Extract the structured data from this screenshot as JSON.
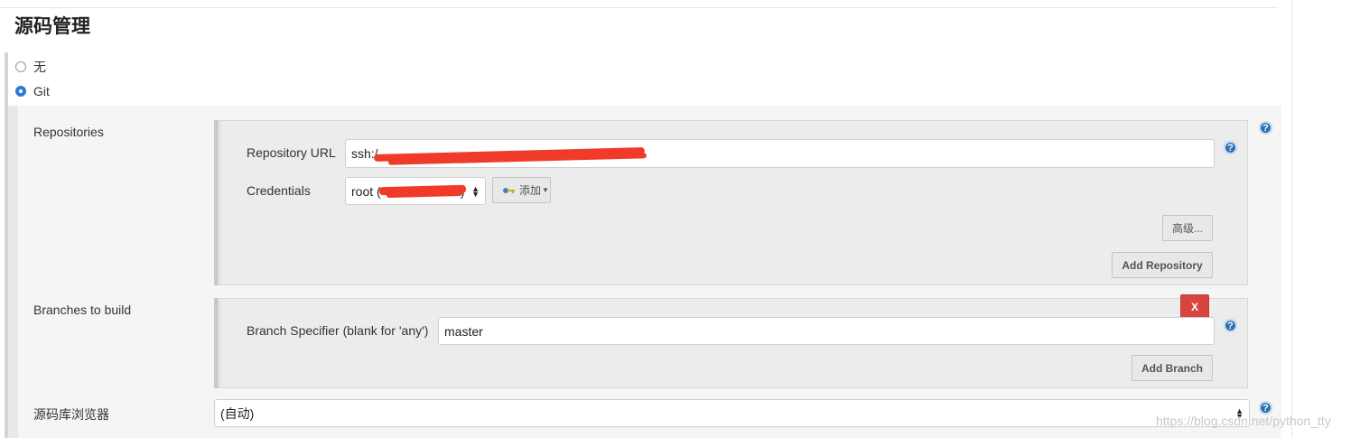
{
  "section": {
    "title": "源码管理"
  },
  "scm": {
    "options": [
      {
        "label": "无",
        "checked": false
      },
      {
        "label": "Git",
        "checked": true
      }
    ]
  },
  "repositories": {
    "label": "Repositories",
    "repository_url_label": "Repository URL",
    "repository_url_value": "ssh:/",
    "credentials_label": "Credentials",
    "credentials_value": "root (",
    "credentials_suffix": ")",
    "add_button": "添加",
    "advanced_button": "高级...",
    "add_repository_button": "Add Repository"
  },
  "branches": {
    "label": "Branches to build",
    "specifier_label": "Branch Specifier (blank for 'any')",
    "specifier_value": "master",
    "delete_button": "X",
    "add_branch_button": "Add Branch"
  },
  "browser": {
    "label": "源码库浏览器",
    "value": "(自动)"
  },
  "help_glyph": "?",
  "watermark": "https://blog.csdn.net/python_tty",
  "colors": {
    "radio_checked": "#2b7cd3",
    "help_icon": "#2a6fb4",
    "delete_button": "#d9453e",
    "redaction": "#f03a2a"
  }
}
